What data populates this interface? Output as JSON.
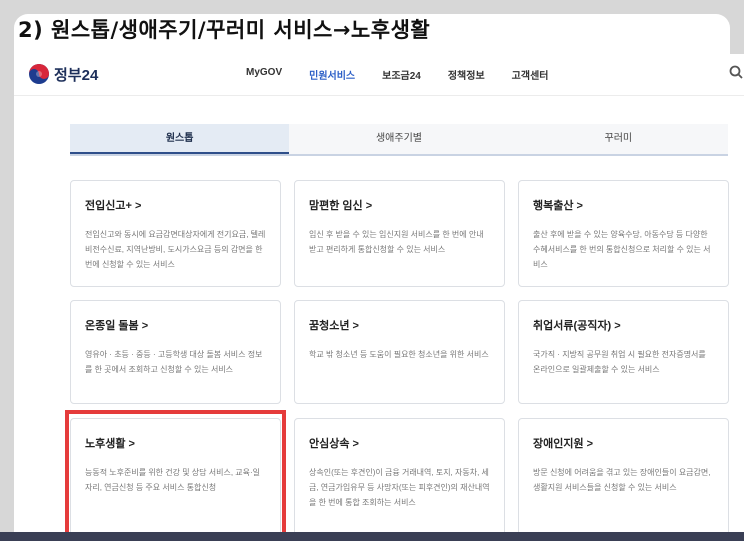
{
  "slide": {
    "title": "2) 원스톱/생애주기/꾸러미 서비스→노후생활"
  },
  "site": {
    "logo_text": "정부24",
    "menu": [
      "MyGOV",
      "민원서비스",
      "보조금24",
      "정책정보",
      "고객센터"
    ],
    "active_menu": "민원서비스",
    "tabs": [
      "원스톱",
      "생애주기별",
      "꾸러미"
    ],
    "active_tab": "원스톱"
  },
  "cards": [
    {
      "title": "전입신고+ >",
      "desc": "전입신고와 동시에 요금감면대상자에게 전기요금, 텔레비전수신료, 지역난방비, 도시가스요금 등의 감면을 한 번에 신청할 수 있는 서비스"
    },
    {
      "title": "맘편한 임신 >",
      "desc": "임신 후 받을 수 있는 임신지원 서비스를 한 번에 안내받고 편리하게 통합신청할 수 있는 서비스"
    },
    {
      "title": "행복출산 >",
      "desc": "출산 후에 받을 수 있는 양육수당, 아동수당 등 다양한 수혜서비스를 한 번의 통합신청으로 처리할 수 있는 서비스"
    },
    {
      "title": "온종일 돌봄 >",
      "desc": "영유아 · 초등 · 중등 · 고등학생 대상 돌봄 서비스 정보를 한 곳에서 조회하고 신청할 수 있는 서비스"
    },
    {
      "title": "꿈청소년 >",
      "desc": "학교 밖 청소년 등 도움이 필요한 청소년을 위한 서비스"
    },
    {
      "title": "취업서류(공직자) >",
      "desc": "국가직 · 지방직 공무원 취업 시 필요한 전자증명서를 온라인으로 일괄제출할 수 있는 서비스"
    },
    {
      "title": "노후생활 >",
      "desc": "능동적 노후준비를 위한 건강 및 상담 서비스, 교육·일자리, 연금신청 등 주요 서비스 통합신청"
    },
    {
      "title": "안심상속 >",
      "desc": "상속인(또는 후견인)이 금융 거래내역, 토지, 자동차, 세금, 연금가입유무 등 사망자(또는 피후견인)의 재산내역을 한 번에 통합 조회하는 서비스"
    },
    {
      "title": "장애인지원 >",
      "desc": "방문 신청에 어려움을 겪고 있는 장애인들이 요금감면, 생활지원 서비스들을 신청할 수 있는 서비스"
    }
  ],
  "highlight_color": "#e53b3b"
}
